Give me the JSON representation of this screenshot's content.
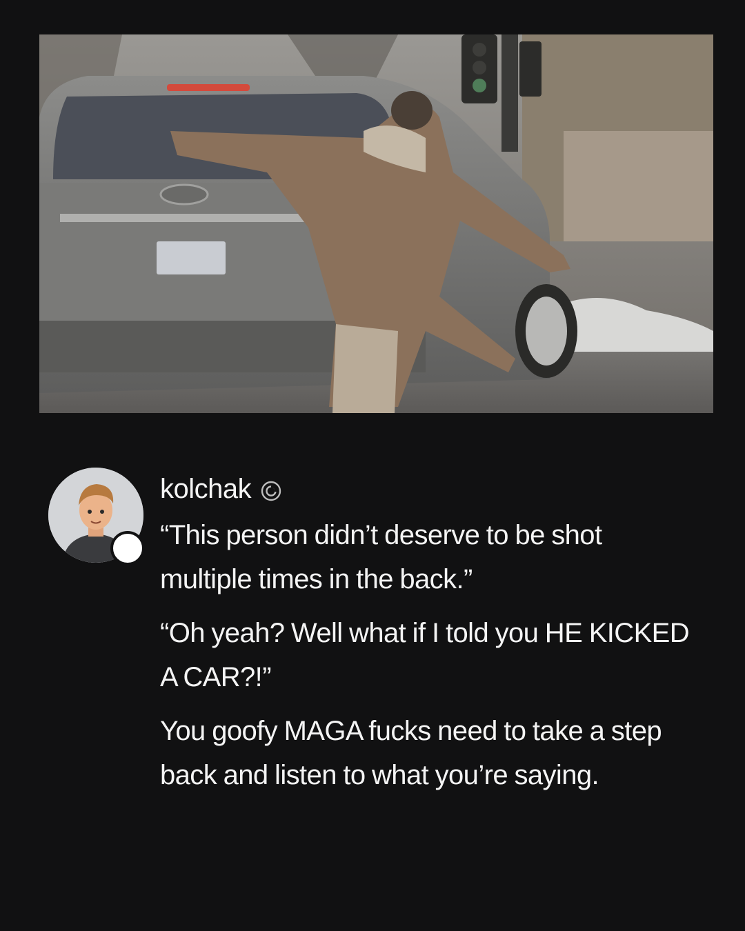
{
  "media": {
    "image_name": "video-still",
    "description_icon": "photo"
  },
  "post": {
    "username": "kolchak",
    "badge_icon": "threads-icon",
    "avatar_icon": "avatar-cartoon-man",
    "paragraphs": [
      "“This person didn’t deserve to be shot multiple times in the back.”",
      "“Oh yeah? Well what if I told you HE KICKED A CAR?!”",
      "You goofy MAGA fucks need to take a step back and listen to what you’re saying."
    ]
  },
  "colors": {
    "background": "#111112",
    "text": "#f4f4f4"
  }
}
